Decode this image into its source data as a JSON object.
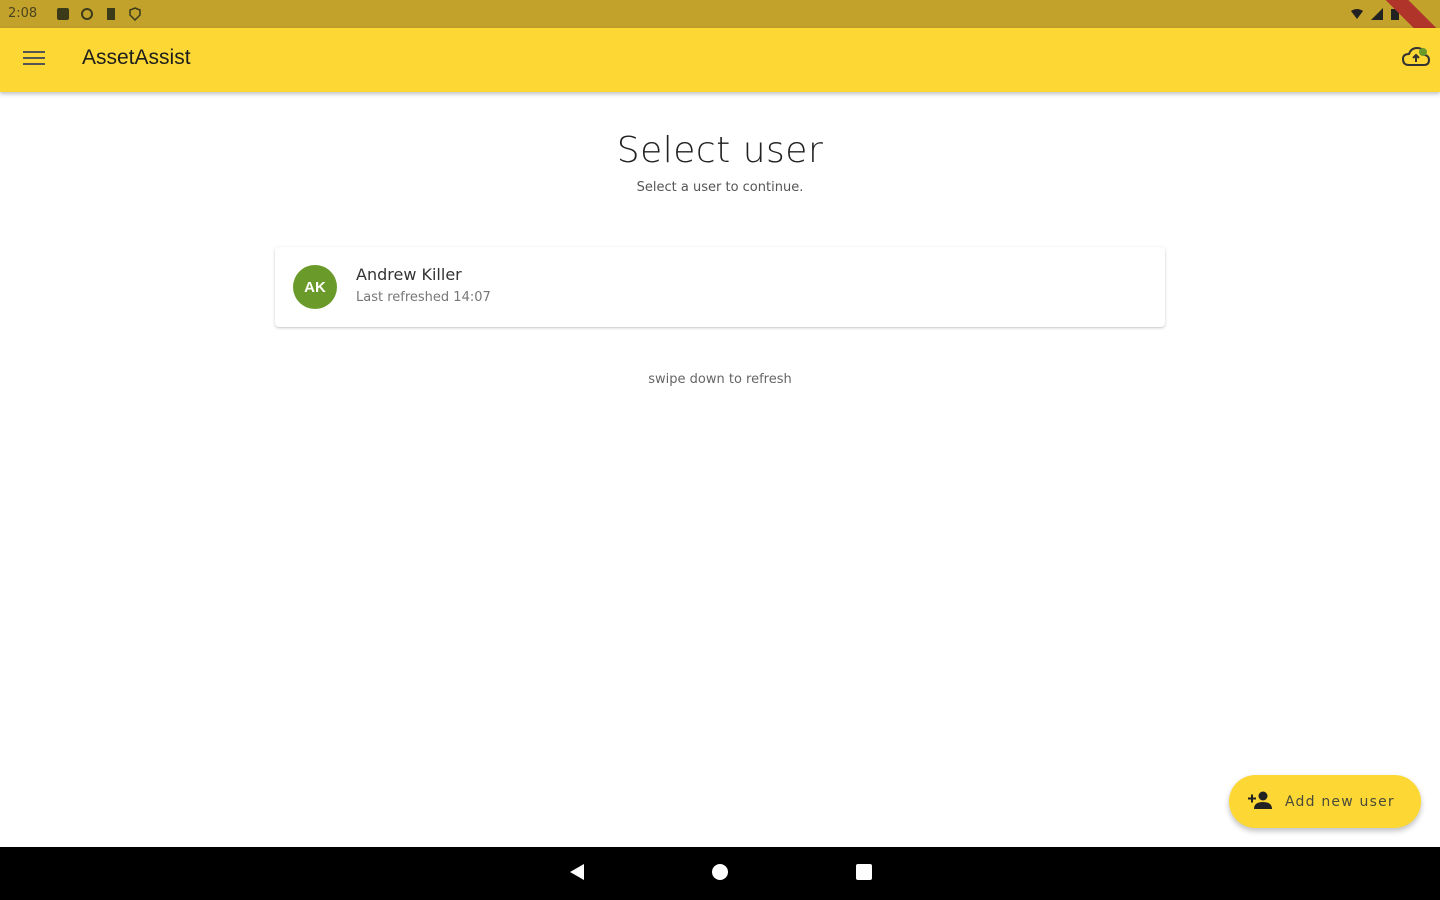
{
  "status_bar": {
    "time": "2:08"
  },
  "app_bar": {
    "title": "AssetAssist"
  },
  "page": {
    "title": "Select user",
    "subtitle": "Select a user to continue.",
    "refresh_hint": "swipe down to refresh"
  },
  "users": [
    {
      "initials": "AK",
      "name": "Andrew Killer",
      "last_refreshed": "Last refreshed 14:07"
    }
  ],
  "fab": {
    "label": "Add new user"
  },
  "colors": {
    "accent": "#fdd835",
    "status_bar": "#c3a22b",
    "avatar": "#6a9b2a"
  },
  "icons": {
    "menu": "menu-icon",
    "sync": "cloud-upload-icon",
    "add_user": "person-add-icon",
    "back": "back-triangle-icon",
    "home": "home-circle-icon",
    "recents": "recents-square-icon"
  }
}
